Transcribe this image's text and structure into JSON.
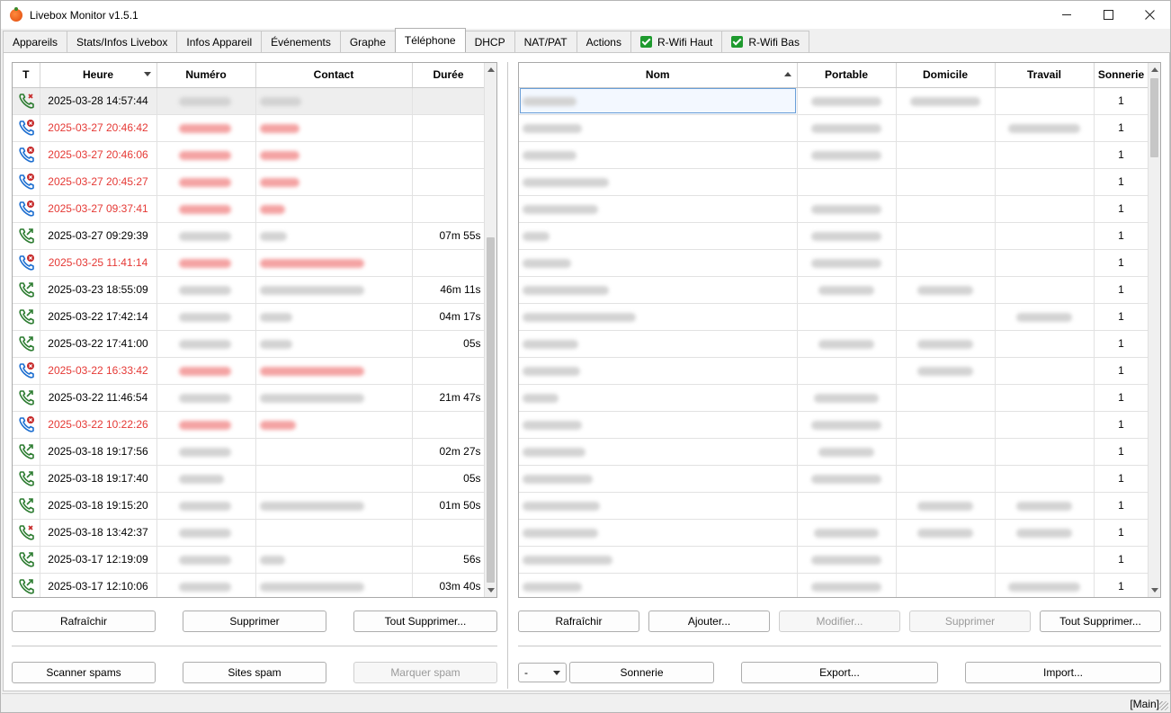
{
  "window": {
    "title": "Livebox Monitor v1.5.1"
  },
  "tabs": [
    {
      "label": "Appareils"
    },
    {
      "label": "Stats/Infos Livebox"
    },
    {
      "label": "Infos Appareil"
    },
    {
      "label": "Événements"
    },
    {
      "label": "Graphe"
    },
    {
      "label": "Téléphone",
      "active": true
    },
    {
      "label": "DHCP"
    },
    {
      "label": "NAT/PAT"
    },
    {
      "label": "Actions"
    },
    {
      "label": "R-Wifi Haut",
      "checked": true
    },
    {
      "label": "R-Wifi Bas",
      "checked": true
    }
  ],
  "calls": {
    "columns": [
      "T",
      "Heure",
      "Numéro",
      "Contact",
      "Durée"
    ],
    "rows": [
      {
        "type": "missed-in",
        "time": "2025-03-28 14:57:44",
        "duration": "",
        "missed": false
      },
      {
        "type": "missed",
        "time": "2025-03-27 20:46:42",
        "duration": "",
        "missed": true
      },
      {
        "type": "missed",
        "time": "2025-03-27 20:46:06",
        "duration": "",
        "missed": true
      },
      {
        "type": "missed",
        "time": "2025-03-27 20:45:27",
        "duration": "",
        "missed": true
      },
      {
        "type": "missed",
        "time": "2025-03-27 09:37:41",
        "duration": "",
        "missed": true
      },
      {
        "type": "outgoing",
        "time": "2025-03-27 09:29:39",
        "duration": "07m 55s",
        "missed": false
      },
      {
        "type": "missed",
        "time": "2025-03-25 11:41:14",
        "duration": "",
        "missed": true
      },
      {
        "type": "outgoing",
        "time": "2025-03-23 18:55:09",
        "duration": "46m 11s",
        "missed": false
      },
      {
        "type": "outgoing",
        "time": "2025-03-22 17:42:14",
        "duration": "04m 17s",
        "missed": false
      },
      {
        "type": "outgoing",
        "time": "2025-03-22 17:41:00",
        "duration": "05s",
        "missed": false
      },
      {
        "type": "missed",
        "time": "2025-03-22 16:33:42",
        "duration": "",
        "missed": true
      },
      {
        "type": "outgoing",
        "time": "2025-03-22 11:46:54",
        "duration": "21m 47s",
        "missed": false
      },
      {
        "type": "missed",
        "time": "2025-03-22 10:22:26",
        "duration": "",
        "missed": true
      },
      {
        "type": "outgoing",
        "time": "2025-03-18 19:17:56",
        "duration": "02m 27s",
        "missed": false
      },
      {
        "type": "outgoing",
        "time": "2025-03-18 19:17:40",
        "duration": "05s",
        "missed": false
      },
      {
        "type": "outgoing",
        "time": "2025-03-18 19:15:20",
        "duration": "01m 50s",
        "missed": false
      },
      {
        "type": "missed-in",
        "time": "2025-03-18 13:42:37",
        "duration": "",
        "missed": false
      },
      {
        "type": "outgoing",
        "time": "2025-03-17 12:19:09",
        "duration": "56s",
        "missed": false
      },
      {
        "type": "outgoing",
        "time": "2025-03-17 12:10:06",
        "duration": "03m 40s",
        "missed": false
      }
    ],
    "buttons": {
      "refresh": "Rafraîchir",
      "delete": "Supprimer",
      "delete_all": "Tout Supprimer...",
      "scan_spam": "Scanner spams",
      "spam_sites": "Sites spam",
      "mark_spam": "Marquer spam"
    }
  },
  "contacts": {
    "columns": [
      "Nom",
      "Portable",
      "Domicile",
      "Travail",
      "Sonnerie"
    ],
    "rows": [
      {
        "ringtone": "1"
      },
      {
        "ringtone": "1"
      },
      {
        "ringtone": "1"
      },
      {
        "ringtone": "1"
      },
      {
        "ringtone": "1"
      },
      {
        "ringtone": "1"
      },
      {
        "ringtone": "1"
      },
      {
        "ringtone": "1"
      },
      {
        "ringtone": "1"
      },
      {
        "ringtone": "1"
      },
      {
        "ringtone": "1"
      },
      {
        "ringtone": "1"
      },
      {
        "ringtone": "1"
      },
      {
        "ringtone": "1"
      },
      {
        "ringtone": "1"
      },
      {
        "ringtone": "1"
      },
      {
        "ringtone": "1"
      },
      {
        "ringtone": "1"
      },
      {
        "ringtone": "1"
      }
    ],
    "buttons": {
      "refresh": "Rafraîchir",
      "add": "Ajouter...",
      "edit": "Modifier...",
      "delete": "Supprimer",
      "delete_all": "Tout Supprimer...",
      "ringtone_select": "-",
      "ringtone": "Sonnerie",
      "export": "Export...",
      "import": "Import..."
    }
  },
  "status": {
    "text": "[Main]"
  },
  "colors": {
    "missed": "#e53935",
    "outgoing": "#2e7d32",
    "missed_icon": "#c62828"
  }
}
